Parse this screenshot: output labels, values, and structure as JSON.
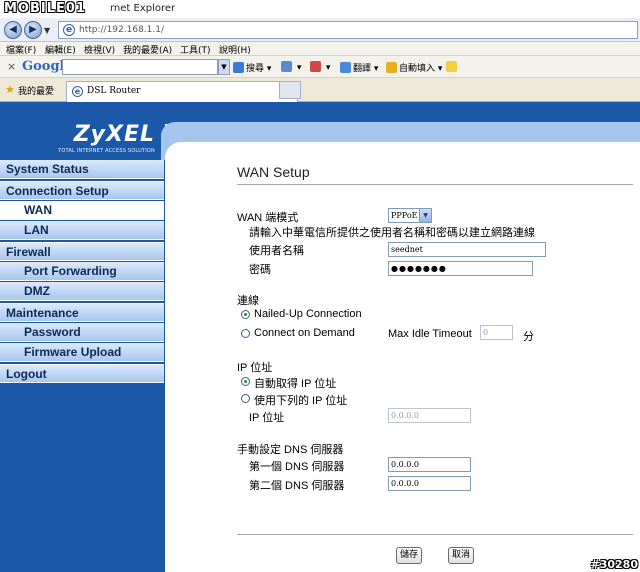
{
  "window": {
    "logo": "MOBILE01",
    "title_fragment": "rnet Explorer"
  },
  "address_bar": {
    "url": "http://192.168.1.1/"
  },
  "menu": {
    "items": [
      "檔案(F)",
      "編輯(E)",
      "檢視(V)",
      "我的最愛(A)",
      "工具(T)",
      "說明(H)"
    ]
  },
  "toolbar": {
    "brand": "Google",
    "search_label": "搜尋",
    "translate_label": "翻譯",
    "autofill_label": "自動填入"
  },
  "tabs": {
    "favorites_label": "我的最愛",
    "active_tab": "DSL Router"
  },
  "router": {
    "brand": "ZyXEL",
    "tagline": "TOTAL INTERNET ACCESS SOLUTION",
    "sidebar": [
      {
        "label": "System Status",
        "level": 0
      },
      {
        "label": "Connection Setup",
        "level": 0,
        "active": true
      },
      {
        "label": "WAN",
        "level": 1,
        "active": true
      },
      {
        "label": "LAN",
        "level": 1
      },
      {
        "label": "Firewall",
        "level": 0
      },
      {
        "label": "Port Forwarding",
        "level": 1
      },
      {
        "label": "DMZ",
        "level": 1
      },
      {
        "label": "Maintenance",
        "level": 0
      },
      {
        "label": "Password",
        "level": 1
      },
      {
        "label": "Firmware Upload",
        "level": 1
      },
      {
        "label": "Logout",
        "level": 0
      }
    ],
    "page_title": "WAN Setup",
    "wan_mode_label": "WAN 端模式",
    "wan_mode_value": "PPPoE",
    "instruction": "請輸入中華電信所提供之使用者名稱和密碼以建立網路連線",
    "username_label": "使用者名稱",
    "username_value": "seednet",
    "password_label": "密碼",
    "password_value": "●●●●●●●",
    "connection_label": "連線",
    "nailed_up_label": "Nailed-Up Connection",
    "on_demand_label": "Connect on Demand",
    "max_idle_label": "Max Idle Timeout",
    "max_idle_value": "0",
    "minutes_label": "分",
    "ip_section_label": "IP 位址",
    "ip_auto_label": "自動取得 IP 位址",
    "ip_manual_label": "使用下列的 IP 位址",
    "ip_field_label": "IP 位址",
    "ip_field_value": "0.0.0.0",
    "dns_section_label": "手動設定 DNS 伺服器",
    "dns1_label": "第一個 DNS 伺服器",
    "dns1_value": "0.0.0.0",
    "dns2_label": "第二個 DNS 伺服器",
    "dns2_value": "0.0.0.0",
    "save_label": "儲存",
    "cancel_label": "取消"
  },
  "watermark": "#30280"
}
